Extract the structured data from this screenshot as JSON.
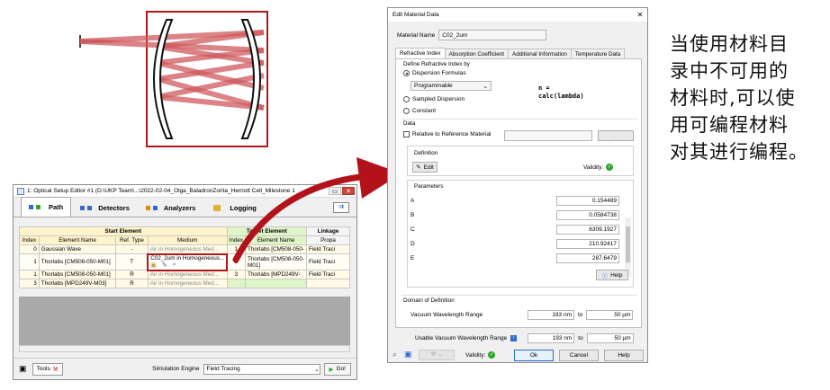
{
  "optical_setup_editor": {
    "title": "1: Optical Setup Editor #1 (D:\\UKP Team\\...\\2022-02-04_Olga_BaladronZorita_Herriott Cell_Milestone 1",
    "tabs": [
      {
        "label": "Path",
        "icon": "path-icon"
      },
      {
        "label": "Detectors",
        "icon": "detectors-icon"
      },
      {
        "label": "Analyzers",
        "icon": "analyzers-icon"
      },
      {
        "label": "Logging",
        "icon": "logging-icon"
      }
    ],
    "group_headers": {
      "start": "Start Element",
      "target": "Target Element",
      "linkage": "Linkage"
    },
    "columns": [
      "Index",
      "Element Name",
      "Ref. Type",
      "Medium",
      "Index",
      "Element Name",
      "Propa"
    ],
    "rows": [
      {
        "index": "0",
        "name": "Gaussian Wave",
        "ref": "-",
        "medium": "Air in Homogeneous Med...",
        "t_index": "1",
        "t_name": "Thorlabs [CM508-050-",
        "prop": "Field Traci"
      },
      {
        "index": "1",
        "name": "Thorlabs [CM508-050-M01]",
        "ref": "T",
        "medium": "C02_2um in Homogeneous...",
        "t_index": "2",
        "t_name": "Thorlabs [CM508-050-M01]",
        "prop": "Field Traci"
      },
      {
        "index": "1",
        "name": "Thorlabs [CM508-050-M01]",
        "ref": "R",
        "medium": "Air in Homogeneous Med...",
        "t_index": "3",
        "t_name": "Thorlabs [MPD249V-",
        "prop": "Field Traci"
      },
      {
        "index": "3",
        "name": "Thorlabs [MPD249V-M03]",
        "ref": "R",
        "medium": "Air in Homogeneous Med...",
        "t_index": "",
        "t_name": "",
        "prop": ""
      }
    ],
    "tools_label": "Tools",
    "engine_label": "Simulation Engine",
    "engine_value": "Field Tracing",
    "go_label": "Go!"
  },
  "edit_material": {
    "title": "Edit Material Data",
    "material_name_label": "Material Name",
    "material_name_value": "C02_2um",
    "tabs": [
      "Refractive Index",
      "Absorption Coefficient",
      "Additional Information",
      "Temperature Data"
    ],
    "define_label": "Define Refractive Index by",
    "opt_dispersion": "Dispersion Formulas",
    "formula_dropdown": "Programmable",
    "formula_text_1": "n =",
    "formula_text_2": "calc(lambda)",
    "opt_sampled": "Sampled Dispersion",
    "opt_constant": "Constant",
    "data_label": "Data",
    "relative_label": "Relative to Reference Material",
    "ref_button": "...",
    "definition_label": "Definition",
    "edit_button": "Edit",
    "validity_label": "Validity:",
    "parameters_label": "Parameters",
    "parameters": [
      {
        "name": "A",
        "value": "0.154489"
      },
      {
        "name": "B",
        "value": "0.0584738"
      },
      {
        "name": "C",
        "value": "6309.1927"
      },
      {
        "name": "D",
        "value": "210.92417"
      },
      {
        "name": "E",
        "value": "287.6479"
      }
    ],
    "help_label": "Help",
    "domain_label": "Domain of Definition",
    "vac_label": "Vacuum Wavelength Range",
    "vac_from": "193 nm",
    "vac_to": "50 µm",
    "to_label": "to",
    "usable_label": "Usable Vacuum Wavelength Range",
    "usable_from": "193 nm",
    "usable_to": "50 µm",
    "ok_label": "Ok",
    "cancel_label": "Cancel",
    "help_button": "Help"
  },
  "caption_lines": [
    "当使用材料目",
    "录中不可用的",
    "材料时,可以使",
    "用可编程材料",
    "对其进行编程。"
  ],
  "colors": {
    "beam": "#cf5a5e",
    "frame": "#b01818",
    "arrow": "#b3121b",
    "valid": "#2aa52a"
  }
}
